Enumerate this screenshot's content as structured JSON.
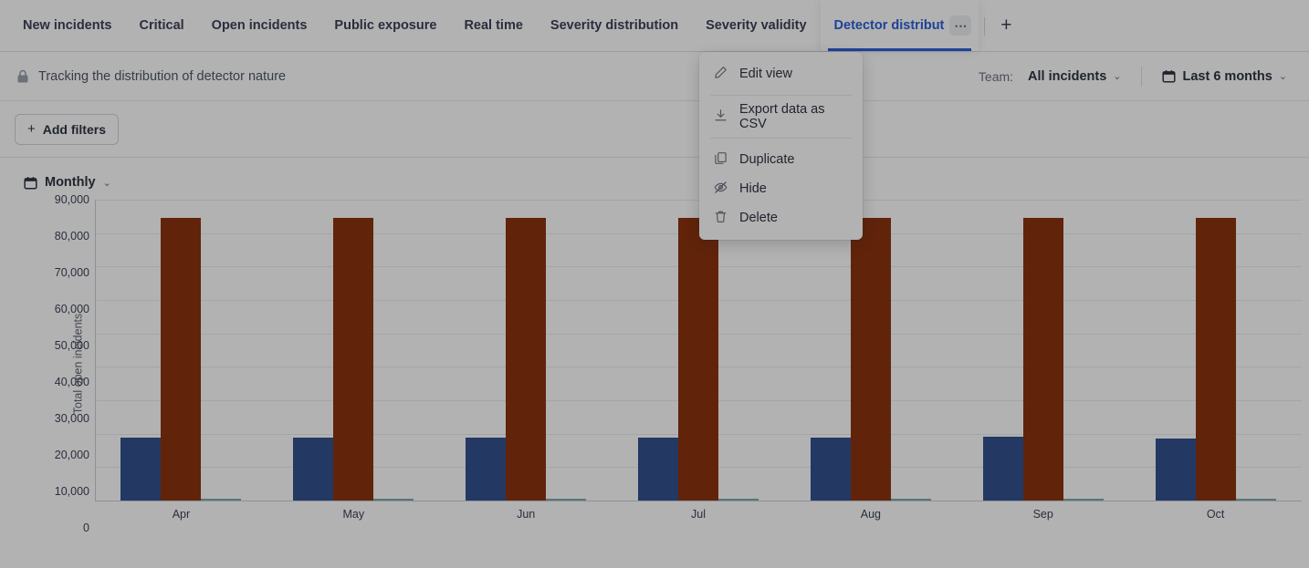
{
  "tabs": [
    {
      "label": "New incidents",
      "active": false
    },
    {
      "label": "Critical",
      "active": false
    },
    {
      "label": "Open incidents",
      "active": false
    },
    {
      "label": "Public exposure",
      "active": false
    },
    {
      "label": "Real time",
      "active": false
    },
    {
      "label": "Severity distribution",
      "active": false
    },
    {
      "label": "Severity validity",
      "active": false
    },
    {
      "label": "Detector distribut",
      "active": true
    }
  ],
  "tab_more_glyph": "⋯",
  "tab_add_glyph": "+",
  "header": {
    "lock_icon": "lock-icon",
    "subtitle": "Tracking the distribution of detector nature",
    "team_label": "Team:",
    "team_value": "All incidents",
    "date_range": "Last 6 months",
    "caret": "⌄",
    "calendar_icon": "calendar-icon"
  },
  "filters": {
    "add_label": "Add filters",
    "plus": "+"
  },
  "granularity": {
    "label": "Monthly",
    "icon": "calendar-icon",
    "caret": "⌄"
  },
  "menu": {
    "items": [
      {
        "label": "Edit view",
        "icon": "pencil-icon",
        "divider_after": true
      },
      {
        "label": "Export data as CSV",
        "icon": "download-icon",
        "divider_after": true
      },
      {
        "label": "Duplicate",
        "icon": "copy-icon",
        "divider_after": false
      },
      {
        "label": "Hide",
        "icon": "eye-off-icon",
        "divider_after": false
      },
      {
        "label": "Delete",
        "icon": "trash-icon",
        "divider_after": false
      }
    ]
  },
  "colors": {
    "series_blue": "#32508d",
    "series_red": "#8b330e",
    "series_teal": "#7fa8a8",
    "accent": "#2b5fd9",
    "grid": "#e9ecef"
  },
  "chart_data": {
    "type": "bar",
    "title": "",
    "xlabel": "",
    "ylabel": "Total open incidents",
    "categories": [
      "Apr",
      "May",
      "Jun",
      "Jul",
      "Aug",
      "Sep",
      "Oct"
    ],
    "ylim": [
      0,
      90000
    ],
    "yticks": [
      90000,
      80000,
      70000,
      60000,
      50000,
      40000,
      30000,
      20000,
      10000,
      0
    ],
    "ytick_labels": [
      "90,000",
      "80,000",
      "70,000",
      "60,000",
      "50,000",
      "40,000",
      "30,000",
      "20,000",
      "10,000",
      "0"
    ],
    "grid": true,
    "legend": "none",
    "series": [
      {
        "name": "series-blue",
        "color": "#32508d",
        "values": [
          18800,
          18800,
          18800,
          18800,
          18800,
          19200,
          18500
        ]
      },
      {
        "name": "series-red",
        "color": "#8b330e",
        "values": [
          84500,
          84500,
          84500,
          84500,
          84500,
          84500,
          84500
        ]
      },
      {
        "name": "series-teal",
        "color": "#7fa8a8",
        "values": [
          450,
          450,
          450,
          450,
          450,
          450,
          450
        ]
      }
    ]
  }
}
